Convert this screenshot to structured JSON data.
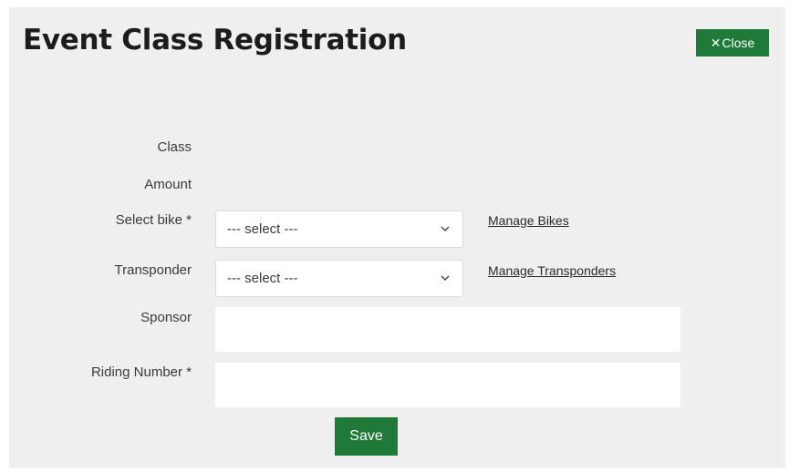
{
  "dialog": {
    "title": "Event Class Registration",
    "close_label": "Close"
  },
  "form": {
    "class_label": "Class",
    "amount_label": "Amount",
    "bike": {
      "label": "Select bike *",
      "value": "--- select ---",
      "link": "Manage Bikes"
    },
    "transponder": {
      "label": "Transponder",
      "value": "--- select ---",
      "link": "Manage Transponders"
    },
    "sponsor": {
      "label": "Sponsor",
      "value": ""
    },
    "riding_number": {
      "label": "Riding Number *",
      "value": ""
    },
    "save_label": "Save"
  },
  "colors": {
    "accent": "#1f7a3a",
    "panel_bg": "#efefef"
  }
}
